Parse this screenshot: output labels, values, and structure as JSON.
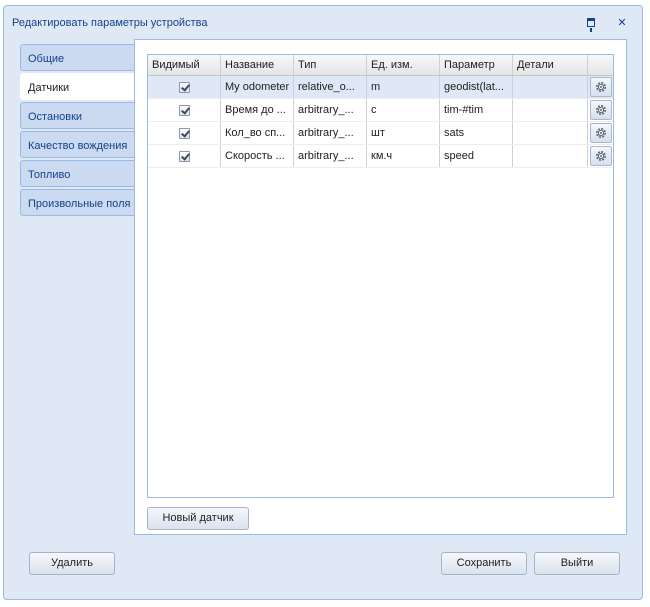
{
  "window": {
    "title": "Редактировать параметры устройства"
  },
  "tabs": [
    {
      "label": "Общие"
    },
    {
      "label": "Датчики",
      "active": true
    },
    {
      "label": "Остановки"
    },
    {
      "label": "Качество вождения"
    },
    {
      "label": "Топливо"
    },
    {
      "label": "Произвольные поля"
    }
  ],
  "grid": {
    "columns": [
      "Видимый",
      "Название",
      "Тип",
      "Ед. изм.",
      "Параметр",
      "Детали"
    ],
    "rows": [
      {
        "visible": true,
        "name": "My odometer",
        "type": "relative_o...",
        "unit": "m",
        "param": "geodist(lat...",
        "details": ""
      },
      {
        "visible": true,
        "name": "Время до ...",
        "type": "arbitrary_...",
        "unit": "с",
        "param": "tim-#tim",
        "details": ""
      },
      {
        "visible": true,
        "name": "Кол_во сп...",
        "type": "arbitrary_...",
        "unit": "шт",
        "param": "sats",
        "details": ""
      },
      {
        "visible": true,
        "name": "Скорость ...",
        "type": "arbitrary_...",
        "unit": "км.ч",
        "param": "speed",
        "details": ""
      }
    ]
  },
  "buttons": {
    "new_sensor": "Новый датчик",
    "delete": "Удалить",
    "save": "Сохранить",
    "exit": "Выйти"
  },
  "icons": {
    "pin": "pin-icon",
    "close": "close-icon",
    "row_action": "gear-icon"
  },
  "colors": {
    "window_bg": "#dfe8f5",
    "border": "#99bbe8",
    "title_text": "#15428b",
    "selected_row": "#dfe8f6"
  }
}
